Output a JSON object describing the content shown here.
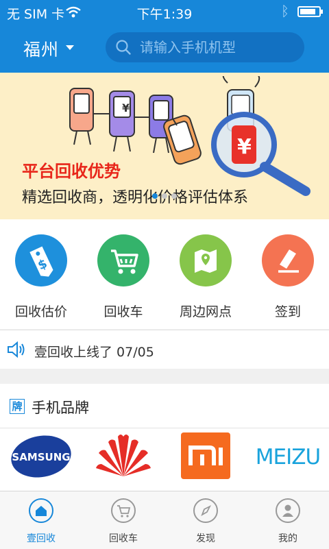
{
  "status_bar": {
    "carrier": "无 SIM 卡",
    "time": "下午1:39",
    "battery_level": 0.85
  },
  "header": {
    "city": "福州",
    "search_placeholder": "请输入手机机型"
  },
  "banner": {
    "title": "平台回收优势",
    "subtitle": "精选回收商，透明化价格评估体系",
    "page_count": 3,
    "active_page": 0
  },
  "actions": [
    {
      "label": "回收估价",
      "icon": "price-tag-icon",
      "color": "#1e90dc"
    },
    {
      "label": "回收车",
      "icon": "cart-icon",
      "color": "#34b36b"
    },
    {
      "label": "周边网点",
      "icon": "map-pin-icon",
      "color": "#86c54a"
    },
    {
      "label": "签到",
      "icon": "eraser-icon",
      "color": "#f47352"
    }
  ],
  "notice": {
    "text": "壹回收上线了  07/05"
  },
  "brands": {
    "badge": "牌",
    "title": "手机品牌",
    "items": [
      {
        "name": "三星",
        "logo_text": "SAMSUNG"
      },
      {
        "name": "华为",
        "logo_text": ""
      },
      {
        "name": "小米",
        "logo_text": "mi"
      },
      {
        "name": "魅族",
        "logo_text": "MEIZU"
      }
    ]
  },
  "tabs": [
    {
      "label": "壹回收",
      "icon": "home-icon",
      "active": true
    },
    {
      "label": "回收车",
      "icon": "cart-icon",
      "active": false
    },
    {
      "label": "发现",
      "icon": "compass-icon",
      "active": false
    },
    {
      "label": "我的",
      "icon": "user-icon",
      "active": false
    }
  ],
  "colors": {
    "primary": "#1787d9",
    "banner_bg": "#fdefc7",
    "banner_title": "#e8261a"
  }
}
